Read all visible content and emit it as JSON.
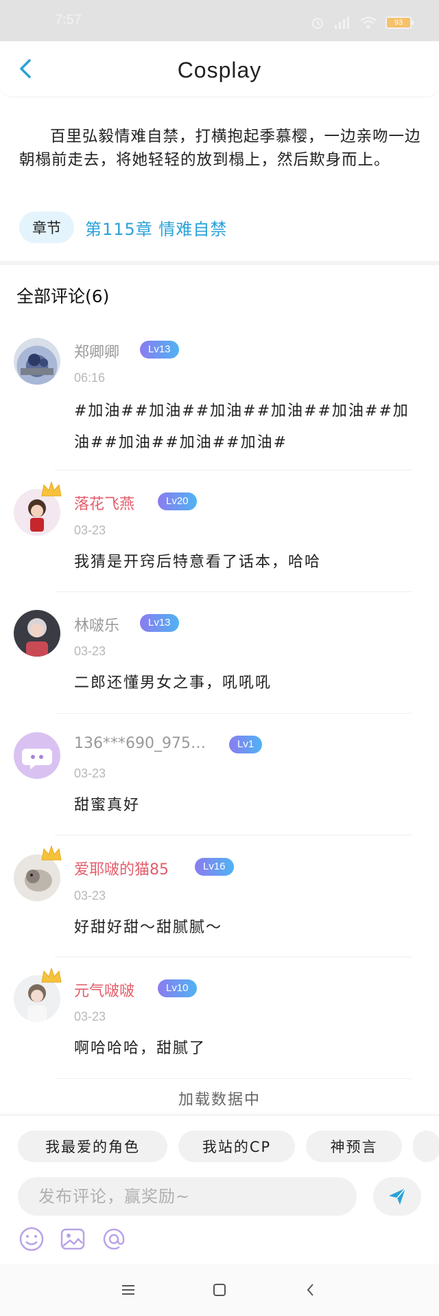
{
  "status_bar": {
    "time": "7:57",
    "battery": "93"
  },
  "nav": {
    "title": "Cosplay"
  },
  "excerpt": "百里弘毅情难自禁，打横抱起季慕樱，一边亲吻一边朝榻前走去，将她轻轻的放到榻上，然后欺身而上。",
  "chapter": {
    "tag": "章节",
    "link": "第115章 情难自禁"
  },
  "comments_title": "全部评论(6)",
  "comments": [
    {
      "name": "郑卿卿",
      "level": "Lv13",
      "time": "06:16",
      "text": "#加油##加油##加油##加油##加油##加油##加油##加油##加油#"
    },
    {
      "name": "落花飞燕",
      "level": "Lv20",
      "time": "03-23",
      "text": "我猜是开窍后特意看了话本，哈哈"
    },
    {
      "name": "林啵乐",
      "level": "Lv13",
      "time": "03-23",
      "text": "二郎还懂男女之事，吼吼吼"
    },
    {
      "name": "136***690_975…",
      "level": "Lv1",
      "time": "03-23",
      "text": "甜蜜真好"
    },
    {
      "name": "爱耶啵的猫85",
      "level": "Lv16",
      "time": "03-23",
      "text": "好甜好甜～甜腻腻～"
    },
    {
      "name": "元气啵啵",
      "level": "Lv10",
      "time": "03-23",
      "text": "啊哈哈哈，甜腻了"
    }
  ],
  "loading_text": "加载数据中",
  "chips": [
    "我最爱的角色",
    "我站的CP",
    "神预言"
  ],
  "input": {
    "placeholder": "发布评论，赢奖励~"
  },
  "colors": {
    "accent": "#2aa1d9",
    "vip_name": "#e35d6a",
    "level_badge_from": "#8a7cf0",
    "level_badge_to": "#4fb3f2"
  },
  "icons": {
    "back": "chevron-left-icon",
    "send": "paper-plane-icon",
    "emoji": "smiley-icon",
    "image": "image-icon",
    "mention": "at-icon"
  }
}
